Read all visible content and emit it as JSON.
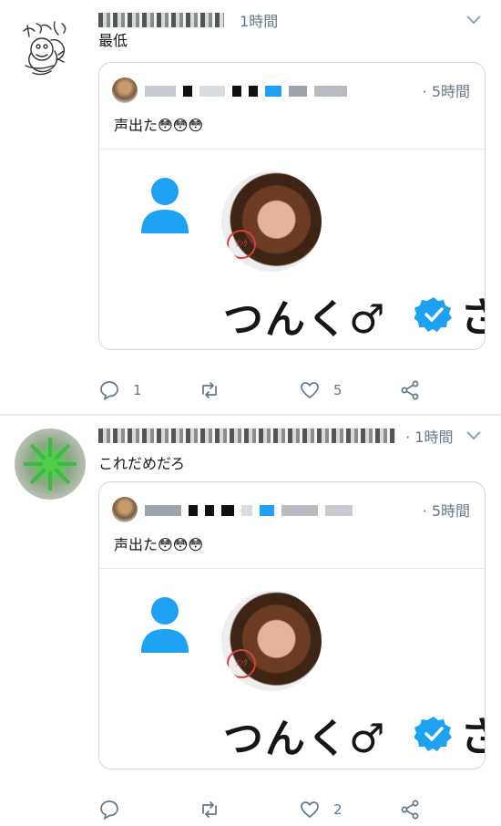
{
  "tweets": [
    {
      "time": "1時間",
      "text": "最低",
      "reply_count": "1",
      "retweet_count": "",
      "like_count": "5",
      "quote": {
        "time": "· 5時間",
        "text": "声出た😳😳😳",
        "media_name": "つんく♂",
        "media_trailing": "さ"
      }
    },
    {
      "time": "· 1時間",
      "text": "これだめだろ",
      "reply_count": "",
      "retweet_count": "",
      "like_count": "2",
      "quote": {
        "time": "· 5時間",
        "text": "声出た😳😳😳",
        "media_name": "つんく♂",
        "media_trailing": "さ"
      }
    }
  ],
  "colors": {
    "icon_gray": "#657786",
    "verified_blue": "#1da1f2",
    "border": "#ccd6dd"
  },
  "icons": [
    "chevron-down-icon",
    "reply-icon",
    "retweet-icon",
    "like-icon",
    "share-icon",
    "person-icon",
    "verified-badge-icon"
  ]
}
